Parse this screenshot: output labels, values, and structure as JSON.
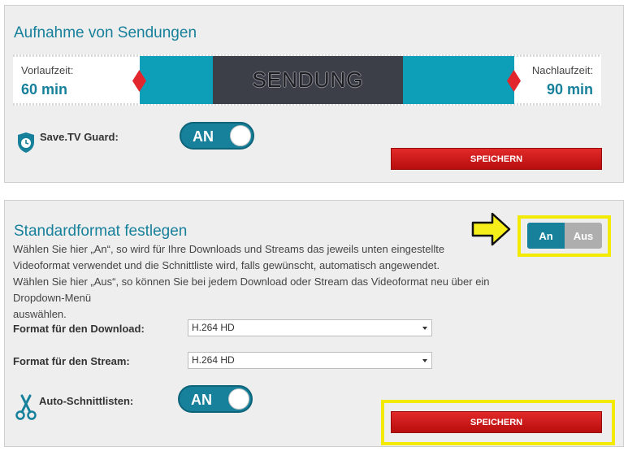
{
  "recording": {
    "title": "Aufnahme von Sendungen",
    "vorlaufzeit_label": "Vorlaufzeit:",
    "vorlaufzeit_value": "60 min",
    "nachlaufzeit_label": "Nachlaufzeit:",
    "nachlaufzeit_value": "90 min",
    "program_label": "SENDUNG",
    "guard_label": "Save.TV Guard:",
    "guard_toggle": "AN",
    "save_label": "SPEICHERN"
  },
  "standard_format": {
    "title": "Standardformat festlegen",
    "desc_line1": "Wählen Sie hier „An“, so wird für Ihre Downloads und Streams das jeweils unten eingestellte",
    "desc_line2": "Videoformat verwendet und die Schnittliste wird, falls gewünscht, automatisch angewendet.",
    "desc_line3": "Wählen Sie hier „Aus“, so können Sie bei jedem Download oder Stream das Videoformat neu über ein Dropdown-Menü",
    "desc_line4": "auswählen.",
    "toggle_on": "An",
    "toggle_off": "Aus",
    "download_label": "Format für den Download:",
    "download_value": "H.264 HD",
    "stream_label": "Format für den Stream:",
    "stream_value": "H.264 HD",
    "auto_label": "Auto-Schnittlisten:",
    "auto_toggle": "AN",
    "save_label": "SPEICHERN"
  },
  "colors": {
    "accent": "#17809b",
    "save": "#d01818",
    "highlight": "#f2ea00"
  }
}
